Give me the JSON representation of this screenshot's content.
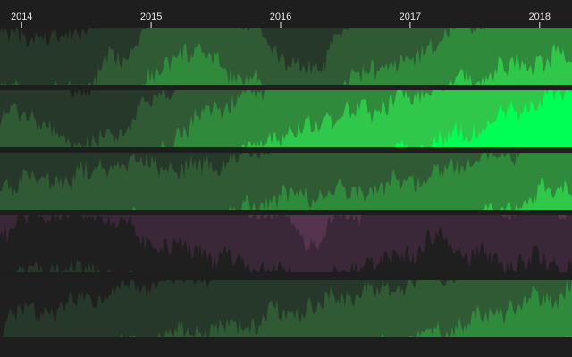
{
  "chart_data": {
    "type": "area",
    "chart_style": "horizon",
    "x_axis": {
      "position": "top",
      "ticks": [
        "2014",
        "2015",
        "2016",
        "2017",
        "2018"
      ],
      "range": [
        "2013-11",
        "2018-04"
      ]
    },
    "band_colors": {
      "positive": [
        "#26382a",
        "#2f5a33",
        "#2f8a3c",
        "#30c84a",
        "#00ff55"
      ],
      "negative": [
        "#3a2838",
        "#54344f"
      ]
    },
    "background": "#1e1e1e",
    "series": [
      {
        "name": "",
        "x": [
          "2013-11",
          "2014-01",
          "2014-04",
          "2014-07",
          "2014-10",
          "2015-01",
          "2015-04",
          "2015-07",
          "2015-10",
          "2016-01",
          "2016-04",
          "2016-07",
          "2016-10",
          "2017-01",
          "2017-04",
          "2017-07",
          "2017-10",
          "2018-01",
          "2018-04"
        ],
        "values": [
          0.9,
          0.85,
          0.8,
          1.0,
          1.5,
          2.1,
          2.6,
          2.4,
          2.1,
          1.5,
          1.2,
          2.0,
          2.3,
          2.4,
          2.9,
          3.1,
          3.3,
          3.4,
          3.5
        ]
      },
      {
        "name": "",
        "x": [
          "2013-11",
          "2014-01",
          "2014-04",
          "2014-07",
          "2014-10",
          "2015-01",
          "2015-04",
          "2015-07",
          "2015-10",
          "2016-01",
          "2016-04",
          "2016-07",
          "2016-10",
          "2017-01",
          "2017-04",
          "2017-07",
          "2017-10",
          "2018-01",
          "2018-04"
        ],
        "values": [
          1.5,
          1.7,
          1.2,
          1.0,
          1.3,
          1.8,
          2.3,
          2.7,
          2.9,
          3.2,
          3.4,
          3.6,
          3.7,
          3.9,
          4.1,
          4.3,
          4.6,
          4.8,
          4.95
        ]
      },
      {
        "name": "",
        "x": [
          "2013-11",
          "2014-01",
          "2014-04",
          "2014-07",
          "2014-10",
          "2015-01",
          "2015-04",
          "2015-07",
          "2015-10",
          "2016-01",
          "2016-04",
          "2016-07",
          "2016-10",
          "2017-01",
          "2017-04",
          "2017-07",
          "2017-10",
          "2018-01",
          "2018-04"
        ],
        "values": [
          1.4,
          1.55,
          1.5,
          1.65,
          1.75,
          1.8,
          1.7,
          1.85,
          2.0,
          2.2,
          2.25,
          2.3,
          2.35,
          2.5,
          2.7,
          2.85,
          3.0,
          3.3,
          3.45
        ]
      },
      {
        "name": "",
        "x": [
          "2013-11",
          "2014-01",
          "2014-04",
          "2014-07",
          "2014-10",
          "2015-01",
          "2015-04",
          "2015-07",
          "2015-10",
          "2016-01",
          "2016-04",
          "2016-07",
          "2016-10",
          "2017-01",
          "2017-04",
          "2017-07",
          "2017-10",
          "2018-01",
          "2018-04"
        ],
        "values": [
          -0.25,
          -0.1,
          0.1,
          0.0,
          -0.05,
          -0.55,
          -0.6,
          -0.7,
          -0.85,
          -1.0,
          -1.45,
          -0.95,
          -0.85,
          -0.65,
          -0.4,
          -0.7,
          -0.85,
          -0.8,
          -0.9
        ]
      },
      {
        "name": "",
        "x": [
          "2013-11",
          "2014-01",
          "2014-04",
          "2014-07",
          "2014-10",
          "2015-01",
          "2015-04",
          "2015-07",
          "2015-10",
          "2016-01",
          "2016-04",
          "2016-07",
          "2016-10",
          "2017-01",
          "2017-04",
          "2017-07",
          "2017-10",
          "2018-01",
          "2018-04"
        ],
        "values": [
          0.25,
          0.4,
          0.5,
          0.7,
          0.85,
          0.95,
          1.05,
          1.1,
          1.2,
          1.45,
          1.55,
          1.7,
          1.8,
          1.95,
          2.1,
          2.3,
          2.5,
          2.65,
          2.8
        ]
      }
    ]
  }
}
